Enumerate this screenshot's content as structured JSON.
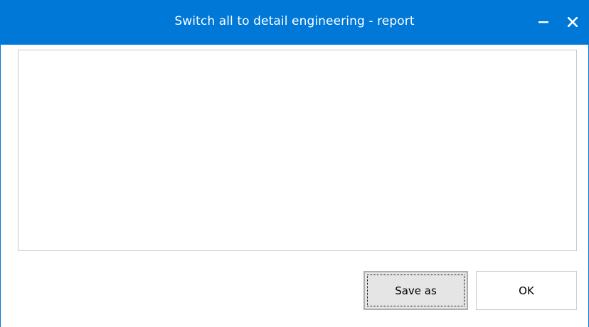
{
  "window": {
    "title": "Switch all to detail engineering - report",
    "accent_color": "#0078d7",
    "minimize_icon": "minimize-icon",
    "close_icon": "close-icon"
  },
  "report": {
    "content": ""
  },
  "buttons": {
    "save_as_label": "Save as",
    "ok_label": "OK"
  }
}
